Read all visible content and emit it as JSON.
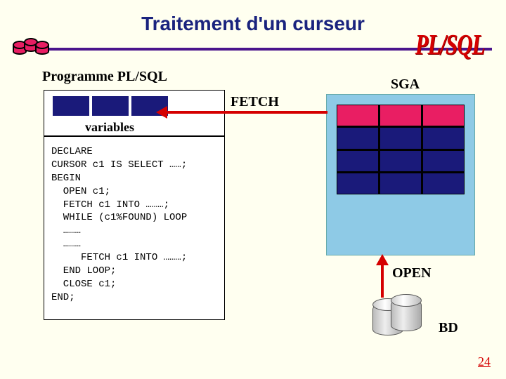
{
  "title": "Traitement d'un curseur",
  "logo": "PL/SQL",
  "labels": {
    "program": "Programme PL/SQL",
    "fetch": "FETCH",
    "sga": "SGA",
    "variables": "variables",
    "open": "OPEN",
    "bd": "BD"
  },
  "code": "DECLARE\nCURSOR c1 IS SELECT ……;\nBEGIN\n  OPEN c1;\n  FETCH c1 INTO ………;\n  WHILE (c1%FOUND) LOOP\n  ………\n  ………\n     FETCH c1 INTO ………;\n  END LOOP;\n  CLOSE c1;\nEND;",
  "sga_grid": {
    "rows": 4,
    "cols": 3,
    "active_row": 0
  },
  "page_number": "24",
  "colors": {
    "title": "#1a237e",
    "accent": "#d50000",
    "cell": "#1a1a7a",
    "pink": "#e91e63",
    "sga_bg": "#8ecae6"
  }
}
